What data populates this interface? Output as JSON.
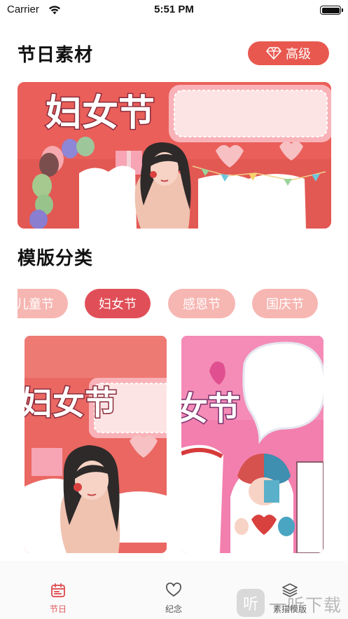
{
  "status_bar": {
    "carrier": "Carrier",
    "time": "5:51 PM"
  },
  "header": {
    "title": "节日素材",
    "premium_label": "高级"
  },
  "banner": {
    "headline": "妇女节"
  },
  "categories": {
    "title": "模版分类",
    "chips": [
      {
        "label": "儿童节",
        "active": false
      },
      {
        "label": "妇女节",
        "active": true
      },
      {
        "label": "感恩节",
        "active": false
      },
      {
        "label": "国庆节",
        "active": false
      }
    ]
  },
  "cards": [
    {
      "headline": "妇女节"
    },
    {
      "headline": "女节"
    }
  ],
  "tab_bar": {
    "tabs": [
      {
        "label": "节日",
        "icon": "calendar-icon",
        "active": true
      },
      {
        "label": "纪念",
        "icon": "heart-icon",
        "active": false
      },
      {
        "label": "素描模版",
        "icon": "layers-icon",
        "active": false
      }
    ]
  },
  "watermark": {
    "text": "一听下载",
    "badge": "听"
  },
  "colors": {
    "accent": "#e8584f",
    "chip_inactive": "#f6b6b2",
    "chip_active": "#e04f58",
    "banner_red": "#ea5f5a",
    "card_pink": "#f27fae"
  }
}
